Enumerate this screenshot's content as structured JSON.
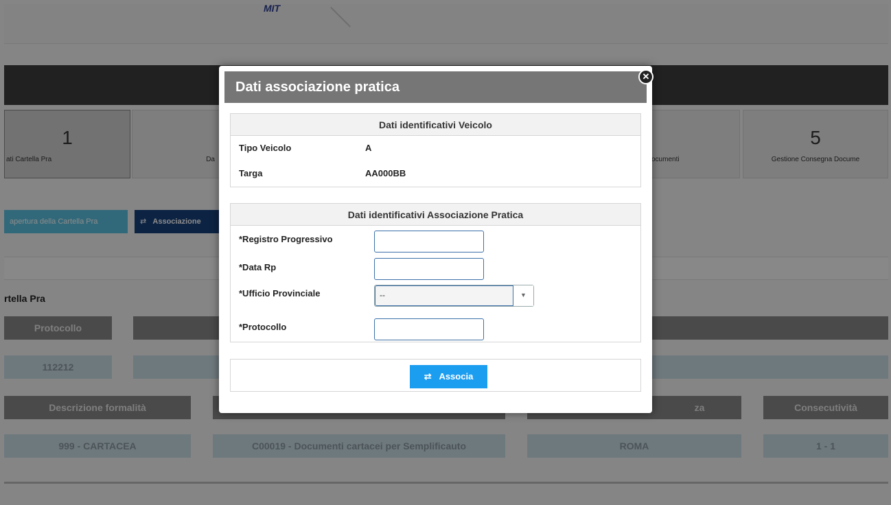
{
  "background": {
    "steps": [
      {
        "num": "1",
        "label": "ati Cartella Pra"
      },
      {
        "num": "",
        "label": "Da"
      },
      {
        "num": "",
        "label": "ocumenti"
      },
      {
        "num": "5",
        "label": "Gestione Consegna Docume"
      }
    ],
    "buttons": {
      "apertura": "apertura della Cartella Pra",
      "associazione": "Associazione"
    },
    "section_title": "rtella Pra",
    "headers": [
      "Protocollo",
      "Descrizione formalità",
      "za",
      "Consecutività"
    ],
    "values": [
      "112212",
      "999 - CARTACEA",
      "C00019 - Documenti cartacei per Semplificauto",
      "ROMA",
      "1 - 1"
    ]
  },
  "modal": {
    "title": "Dati associazione pratica",
    "close_icon": "close-icon",
    "vehicle_panel": {
      "title": "Dati identificativi Veicolo",
      "rows": [
        {
          "label": "Tipo Veicolo",
          "value": "A"
        },
        {
          "label": "Targa",
          "value": "AA000BB"
        }
      ]
    },
    "association_panel": {
      "title": "Dati identificativi Associazione Pratica",
      "registro_label": "*Registro Progressivo",
      "registro_value": "",
      "data_label": "*Data Rp",
      "data_value": "",
      "ufficio_label": "*Ufficio Provinciale",
      "ufficio_selected": "--",
      "protocollo_label": "*Protocollo",
      "protocollo_value": ""
    },
    "associa_button": "Associa",
    "associa_icon": "swap-arrows-icon"
  }
}
